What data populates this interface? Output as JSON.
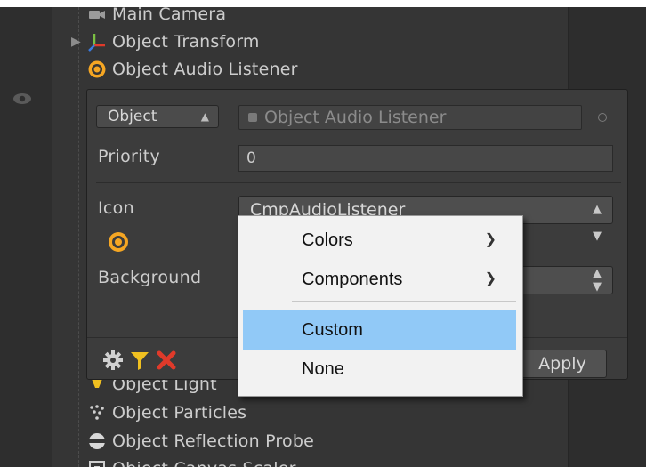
{
  "hierarchy": {
    "items": [
      {
        "label": "Main Camera",
        "icon": "camera-icon"
      },
      {
        "label": "Object Transform",
        "icon": "transform-axes-icon"
      },
      {
        "label": "Object Audio Listener",
        "icon": "audio-listener-icon"
      },
      {
        "label": "Object Light",
        "icon": "light-icon"
      },
      {
        "label": "Object Particles",
        "icon": "particles-icon"
      },
      {
        "label": "Object Reflection Probe",
        "icon": "reflection-probe-icon"
      },
      {
        "label": "Object Canvas Scaler",
        "icon": "canvas-scaler-icon"
      }
    ]
  },
  "inspector": {
    "type_select": "Object",
    "name_field": "Object Audio Listener",
    "priority_label": "Priority",
    "priority_value": "0",
    "icon_label": "Icon",
    "icon_value": "CmpAudioListener",
    "background_label": "Background",
    "apply_label": "Apply"
  },
  "context_menu": {
    "items": [
      {
        "label": "Colors",
        "submenu": true
      },
      {
        "label": "Components",
        "submenu": true
      },
      {
        "label": "Custom",
        "submenu": false,
        "highlighted": true
      },
      {
        "label": "None",
        "submenu": false
      }
    ]
  },
  "colors": {
    "accent_orange": "#f5a623",
    "menu_highlight": "#91c9f7",
    "delete_red": "#e03a2a",
    "filter_yellow": "#f0c020"
  }
}
